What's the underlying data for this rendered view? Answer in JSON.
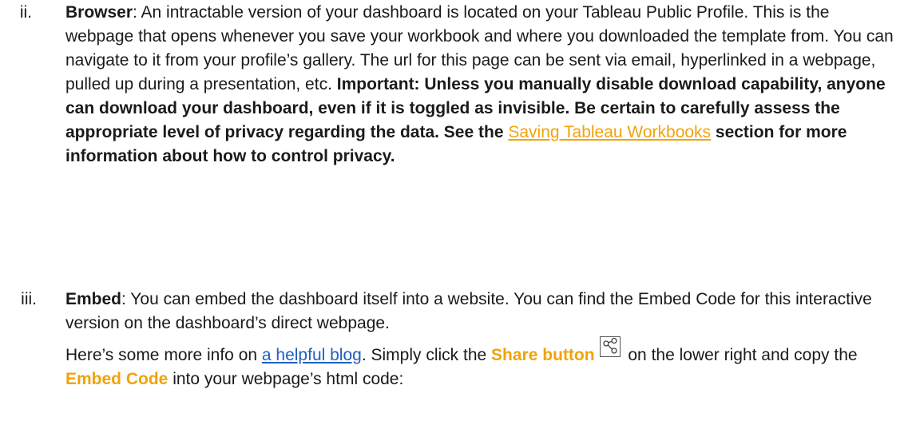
{
  "items": [
    {
      "marker": "ii.",
      "label": "Browser",
      "text_1": ": An intractable version of your dashboard is located on your Tableau Public Profile. This is the webpage that opens whenever you save your workbook and where you downloaded the template from. You can navigate to it from your profile’s gallery. The url for this page can be sent via email, hyperlinked in a webpage, pulled up during a presentation, etc. ",
      "important": "Important: Unless you manually disable download capability, anyone can download your dashboard, even if it is toggled as invisible. Be certain to carefully assess the appropriate level of privacy regarding the data. See the ",
      "link_text": "Saving Tableau Workbooks",
      "important_tail": " section for more information about how to control privacy."
    },
    {
      "marker": "iii.",
      "label": "Embed",
      "text_1": ": You can embed the dashboard itself into a website. You can find the Embed Code for this interactive version on the dashboard’s direct webpage.",
      "p2_start": "Here’s some more info on ",
      "p2_link": "a helpful blog",
      "p2_mid": ". Simply click the ",
      "share_label": "Share button",
      "p2_after_icon": " on the lower right and copy the ",
      "embed_label": "Embed Code",
      "p2_end": " into your webpage’s html code:"
    }
  ],
  "icons": {
    "share": "share-icon"
  },
  "colors": {
    "highlight": "#f0a30a",
    "link_blue": "#1f5fbf",
    "text": "#1a1a1a"
  }
}
